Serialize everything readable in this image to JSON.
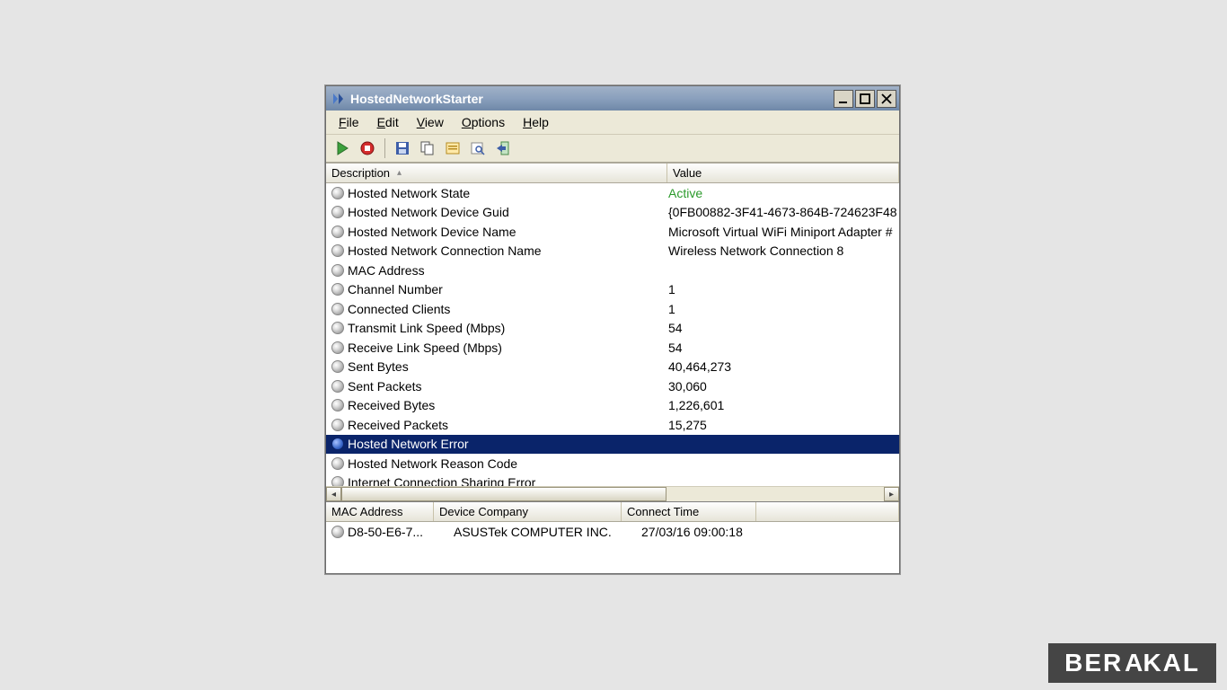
{
  "window": {
    "title": "HostedNetworkStarter"
  },
  "menu": {
    "file": "File",
    "edit": "Edit",
    "view": "View",
    "options": "Options",
    "help": "Help"
  },
  "toolbar": {
    "play": "play-icon",
    "stop": "stop-icon",
    "save": "save-icon",
    "copy": "copy-icon",
    "properties": "properties-icon",
    "find": "find-icon",
    "exit": "exit-icon"
  },
  "columns": {
    "description": "Description",
    "value": "Value"
  },
  "rows": [
    {
      "desc": "Hosted Network State",
      "val": "Active",
      "active": true
    },
    {
      "desc": "Hosted Network Device Guid",
      "val": "{0FB00882-3F41-4673-864B-724623F48"
    },
    {
      "desc": "Hosted Network Device Name",
      "val": "Microsoft Virtual WiFi Miniport Adapter #"
    },
    {
      "desc": "Hosted Network Connection Name",
      "val": "Wireless Network Connection 8"
    },
    {
      "desc": "MAC Address",
      "val": ""
    },
    {
      "desc": "Channel Number",
      "val": "1"
    },
    {
      "desc": "Connected Clients",
      "val": "1"
    },
    {
      "desc": "Transmit Link Speed (Mbps)",
      "val": "54"
    },
    {
      "desc": "Receive Link Speed (Mbps)",
      "val": "54"
    },
    {
      "desc": "Sent Bytes",
      "val": "40,464,273"
    },
    {
      "desc": "Sent Packets",
      "val": "30,060"
    },
    {
      "desc": "Received Bytes",
      "val": "1,226,601"
    },
    {
      "desc": "Received Packets",
      "val": "15,275"
    },
    {
      "desc": "Hosted Network Error",
      "val": "",
      "selected": true
    },
    {
      "desc": "Hosted Network Reason Code",
      "val": ""
    },
    {
      "desc": "Internet Connection Sharing Error",
      "val": ""
    }
  ],
  "clients_columns": {
    "mac": "MAC Address",
    "company": "Device Company",
    "time": "Connect Time"
  },
  "clients": [
    {
      "mac": "D8-50-E6-7...",
      "company": "ASUSTek COMPUTER INC.",
      "time": "27/03/16 09:00:18"
    }
  ],
  "watermark": "BERAKAL"
}
